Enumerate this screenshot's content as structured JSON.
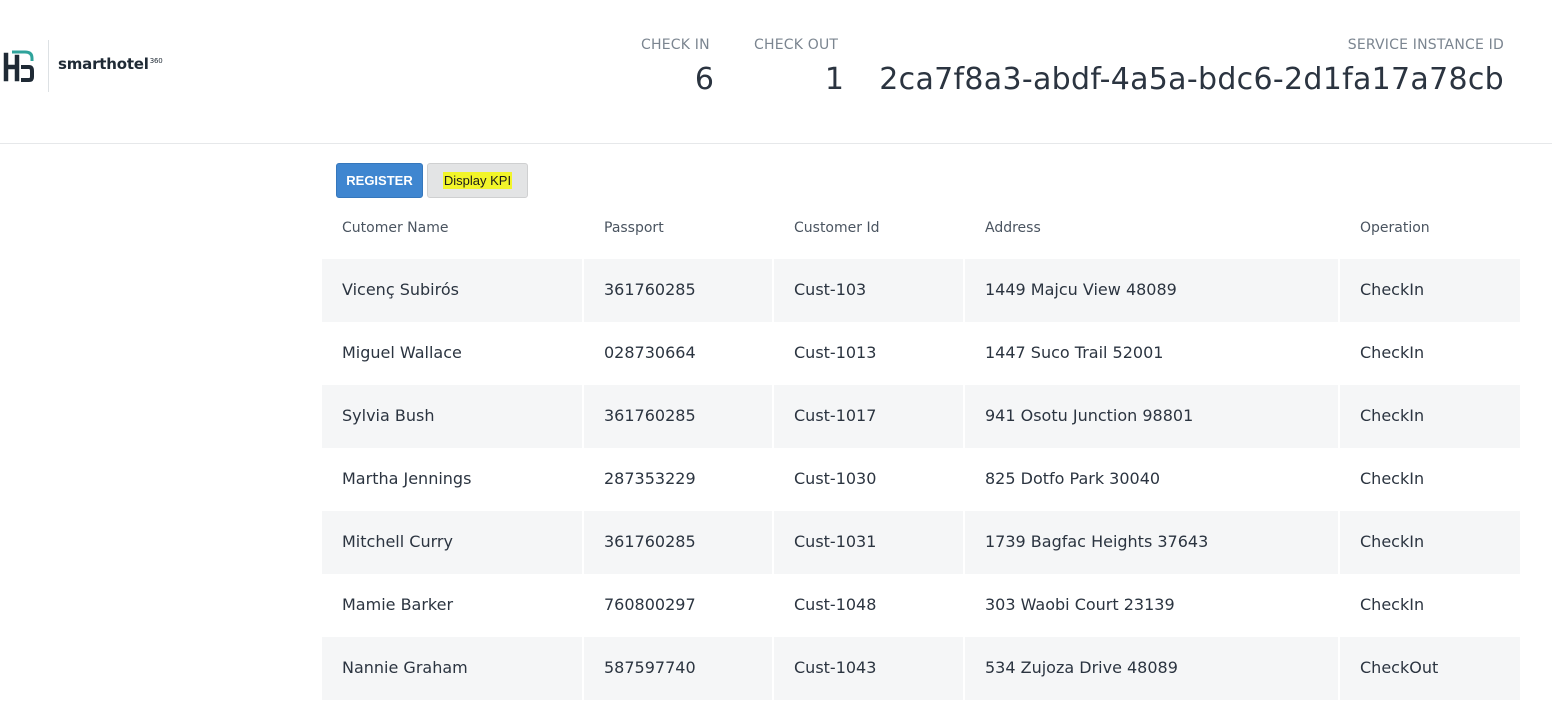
{
  "brand": {
    "name": "smarthotel",
    "superscript": "360"
  },
  "stats": {
    "checkin_label": "CHECK IN",
    "checkin_value": "6",
    "checkout_label": "CHECK OUT",
    "checkout_value": "1",
    "service_instance_label": "SERVICE INSTANCE ID",
    "service_instance_value": "2ca7f8a3-abdf-4a5a-bdc6-2d1fa17a78cb"
  },
  "buttons": {
    "register": "REGISTER",
    "display_kpi": "Display KPI"
  },
  "table": {
    "headers": [
      "Cutomer Name",
      "Passport",
      "Customer Id",
      "Address",
      "Operation"
    ],
    "rows": [
      [
        "Vicenç Subirós",
        "361760285",
        "Cust-103",
        "1449 Majcu View 48089",
        "CheckIn"
      ],
      [
        "Miguel Wallace",
        "028730664",
        "Cust-1013",
        "1447 Suco Trail 52001",
        "CheckIn"
      ],
      [
        "Sylvia Bush",
        "361760285",
        "Cust-1017",
        "941 Osotu Junction 98801",
        "CheckIn"
      ],
      [
        "Martha Jennings",
        "287353229",
        "Cust-1030",
        "825 Dotfo Park 30040",
        "CheckIn"
      ],
      [
        "Mitchell Curry",
        "361760285",
        "Cust-1031",
        "1739 Bagfac Heights 37643",
        "CheckIn"
      ],
      [
        "Mamie Barker",
        "760800297",
        "Cust-1048",
        "303 Waobi Court 23139",
        "CheckIn"
      ],
      [
        "Nannie Graham",
        "587597740",
        "Cust-1043",
        "534 Zujoza Drive 48089",
        "CheckOut"
      ]
    ]
  },
  "colors": {
    "primary_button": "#3f86d0",
    "highlight": "#f2f52a",
    "row_stripe": "#f5f6f7",
    "logo_accent": "#2fa39b"
  }
}
